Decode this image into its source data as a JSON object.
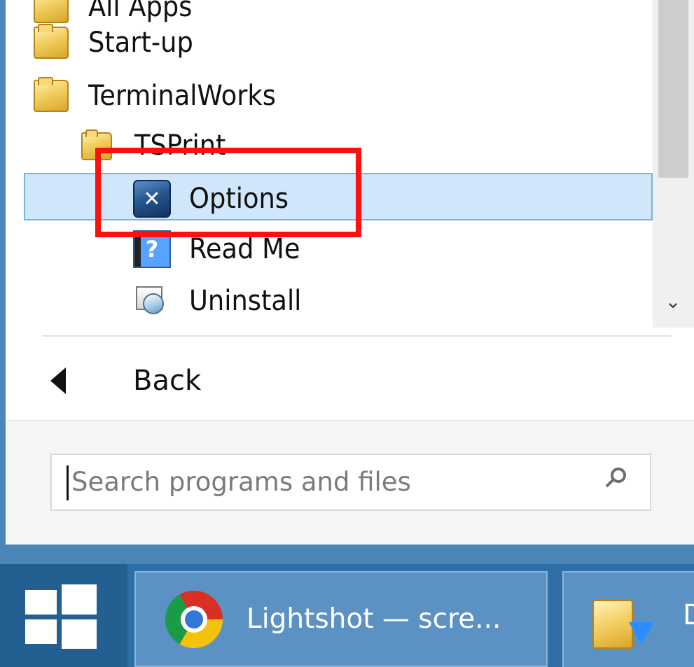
{
  "start_menu": {
    "partial_item_label": "All Apps",
    "folders": [
      {
        "label": "Start-up",
        "icon": "folder-icon"
      },
      {
        "label": "TerminalWorks",
        "icon": "folder-icon"
      },
      {
        "label": "TSPrint",
        "icon": "folder-icon"
      }
    ],
    "shortcuts": [
      {
        "label": "Options",
        "icon": "options-icon",
        "glyph": "✕"
      },
      {
        "label": "Read Me",
        "icon": "readme-icon",
        "glyph": "?"
      },
      {
        "label": "Uninstall",
        "icon": "uninstall-icon"
      }
    ],
    "selected_item": "Options",
    "scroll_down_glyph": "⌄",
    "back_label": "Back",
    "search": {
      "placeholder": "Search programs and files",
      "value": ""
    }
  },
  "taskbar": {
    "items": [
      {
        "label": "Lightshot — scre...",
        "icon": "chrome-icon"
      },
      {
        "label": "D",
        "icon": "explorer-icon"
      }
    ]
  },
  "colors": {
    "selection": "#cfe6fb",
    "selection_border": "#77b3e3",
    "annotation": "#ff1010",
    "taskbar": "#2d6fa6"
  }
}
